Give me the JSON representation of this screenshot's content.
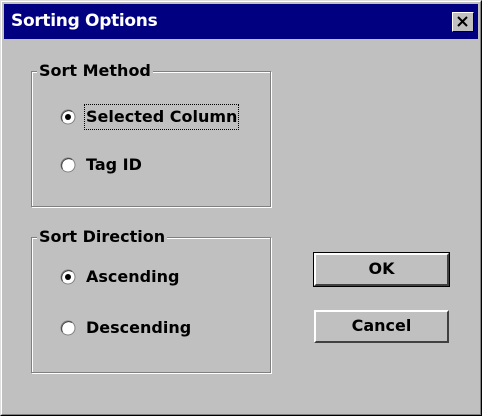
{
  "window": {
    "title": "Sorting Options",
    "close_label": "×"
  },
  "sort_method": {
    "label": "Sort Method",
    "options": [
      {
        "label": "Selected Column",
        "selected": true
      },
      {
        "label": "Tag ID",
        "selected": false
      }
    ]
  },
  "sort_direction": {
    "label": "Sort Direction",
    "options": [
      {
        "label": "Ascending",
        "selected": true
      },
      {
        "label": "Descending",
        "selected": false
      }
    ]
  },
  "buttons": {
    "ok": "OK",
    "cancel": "Cancel"
  }
}
